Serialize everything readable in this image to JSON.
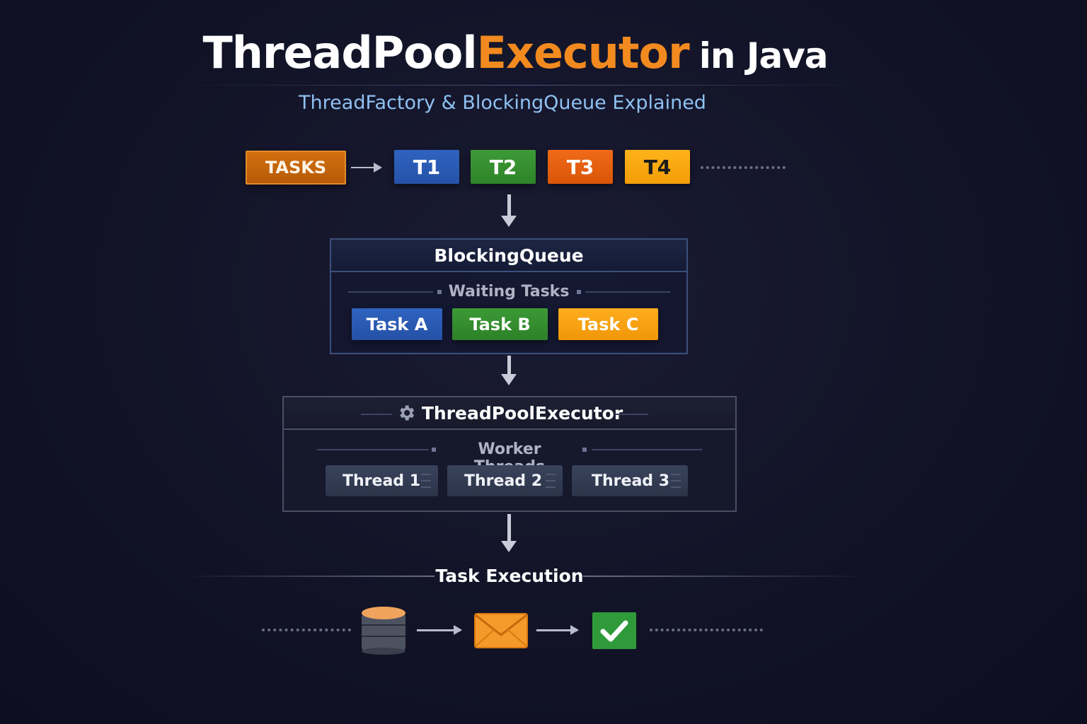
{
  "title": {
    "part1": "ThreadPool",
    "part2": "Executor",
    "part3": "in Java"
  },
  "subtitle": "ThreadFactory & BlockingQueue Explained",
  "tasks_row": {
    "tasks_label": "TASKS",
    "items": [
      "T1",
      "T2",
      "T3",
      "T4"
    ]
  },
  "blocking_queue": {
    "title": "BlockingQueue",
    "section_label": "Waiting Tasks",
    "tasks": [
      "Task A",
      "Task B",
      "Task C"
    ]
  },
  "executor": {
    "title": "ThreadPoolExecutor",
    "section_label": "Worker Threads",
    "threads": [
      "Thread 1",
      "Thread 2",
      "Thread 3"
    ]
  },
  "execution": {
    "label": "Task Execution",
    "icons": [
      "database-icon",
      "envelope-icon",
      "checkmark-icon"
    ]
  },
  "colors": {
    "accent_orange": "#f28a1f",
    "subtitle_blue": "#8fc1f2",
    "t1": "#2f63c0",
    "t2": "#3d9a37",
    "t3": "#f06a18",
    "t4": "#ffb21a"
  }
}
